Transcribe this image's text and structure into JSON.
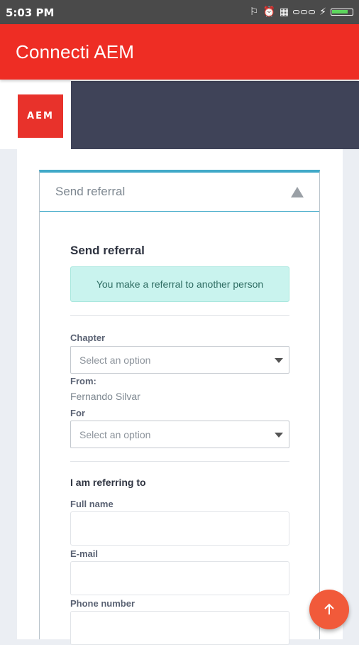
{
  "status_bar": {
    "time": "5:03 PM",
    "icons": [
      "usb-icon",
      "alarm-icon",
      "sim-icon",
      "signal-icon",
      "charging-icon",
      "battery-icon"
    ]
  },
  "app_bar": {
    "title": "Connecti AEM"
  },
  "header": {
    "logo_text": "AEM"
  },
  "panel": {
    "header_label": "Send referral",
    "title": "Send referral",
    "notice": "You make a referral to another person",
    "chapter_label": "Chapter",
    "chapter_placeholder": "Select an option",
    "from_label": "From:",
    "from_value": "Fernando Silvar",
    "for_label": "For",
    "for_placeholder": "Select an option",
    "referring_title": "I am referring to",
    "full_name_label": "Full name",
    "email_label": "E-mail",
    "phone_label": "Phone number"
  },
  "colors": {
    "app_bar": "#ee2d24",
    "header_dark": "#3f4358",
    "panel_accent": "#41a9c8",
    "notice_bg": "#c9f3ee",
    "fab": "#f15a3a"
  }
}
